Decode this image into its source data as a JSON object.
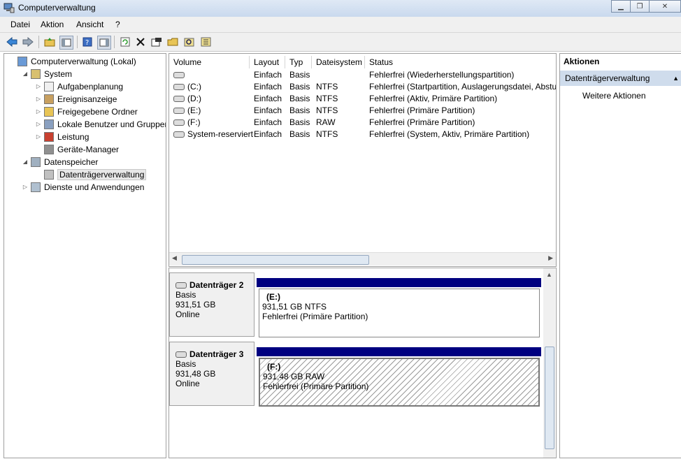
{
  "window": {
    "title": "Computerverwaltung"
  },
  "menu": [
    "Datei",
    "Aktion",
    "Ansicht",
    "?"
  ],
  "tree": [
    {
      "label": "Computerverwaltung (Lokal)",
      "level": 0,
      "expander": ""
    },
    {
      "label": "System",
      "level": 1,
      "expander": "◢"
    },
    {
      "label": "Aufgabenplanung",
      "level": 2,
      "expander": "▷"
    },
    {
      "label": "Ereignisanzeige",
      "level": 2,
      "expander": "▷"
    },
    {
      "label": "Freigegebene Ordner",
      "level": 2,
      "expander": "▷"
    },
    {
      "label": "Lokale Benutzer und Gruppen",
      "level": 2,
      "expander": "▷"
    },
    {
      "label": "Leistung",
      "level": 2,
      "expander": "▷"
    },
    {
      "label": "Geräte-Manager",
      "level": 2,
      "expander": ""
    },
    {
      "label": "Datenspeicher",
      "level": 1,
      "expander": "◢"
    },
    {
      "label": "Datenträgerverwaltung",
      "level": 2,
      "expander": "",
      "selected": true
    },
    {
      "label": "Dienste und Anwendungen",
      "level": 1,
      "expander": "▷"
    }
  ],
  "columns": [
    "Volume",
    "Layout",
    "Typ",
    "Dateisystem",
    "Status"
  ],
  "volumes": [
    {
      "volume": "",
      "layout": "Einfach",
      "typ": "Basis",
      "fs": "",
      "status": "Fehlerfrei (Wiederherstellungspartition)"
    },
    {
      "volume": "(C:)",
      "layout": "Einfach",
      "typ": "Basis",
      "fs": "NTFS",
      "status": "Fehlerfrei (Startpartition, Auslagerungsdatei, Absturz"
    },
    {
      "volume": "(D:)",
      "layout": "Einfach",
      "typ": "Basis",
      "fs": "NTFS",
      "status": "Fehlerfrei (Aktiv, Primäre Partition)"
    },
    {
      "volume": "(E:)",
      "layout": "Einfach",
      "typ": "Basis",
      "fs": "NTFS",
      "status": "Fehlerfrei (Primäre Partition)"
    },
    {
      "volume": "(F:)",
      "layout": "Einfach",
      "typ": "Basis",
      "fs": "RAW",
      "status": "Fehlerfrei (Primäre Partition)"
    },
    {
      "volume": "System-reserviert",
      "layout": "Einfach",
      "typ": "Basis",
      "fs": "NTFS",
      "status": "Fehlerfrei (System, Aktiv, Primäre Partition)"
    }
  ],
  "disks": [
    {
      "name": "Datenträger 2",
      "type": "Basis",
      "size": "931,51 GB",
      "state": "Online",
      "partition": {
        "letter": "(E:)",
        "size_fs": "931,51 GB NTFS",
        "status": "Fehlerfrei (Primäre Partition)"
      }
    },
    {
      "name": "Datenträger 3",
      "type": "Basis",
      "size": "931,48 GB",
      "state": "Online",
      "partition": {
        "letter": "(F:)",
        "size_fs": "931,48 GB RAW",
        "status": "Fehlerfrei (Primäre Partition)"
      }
    }
  ],
  "actions": {
    "header": "Aktionen",
    "section": "Datenträgerverwaltung",
    "item": "Weitere Aktionen"
  }
}
